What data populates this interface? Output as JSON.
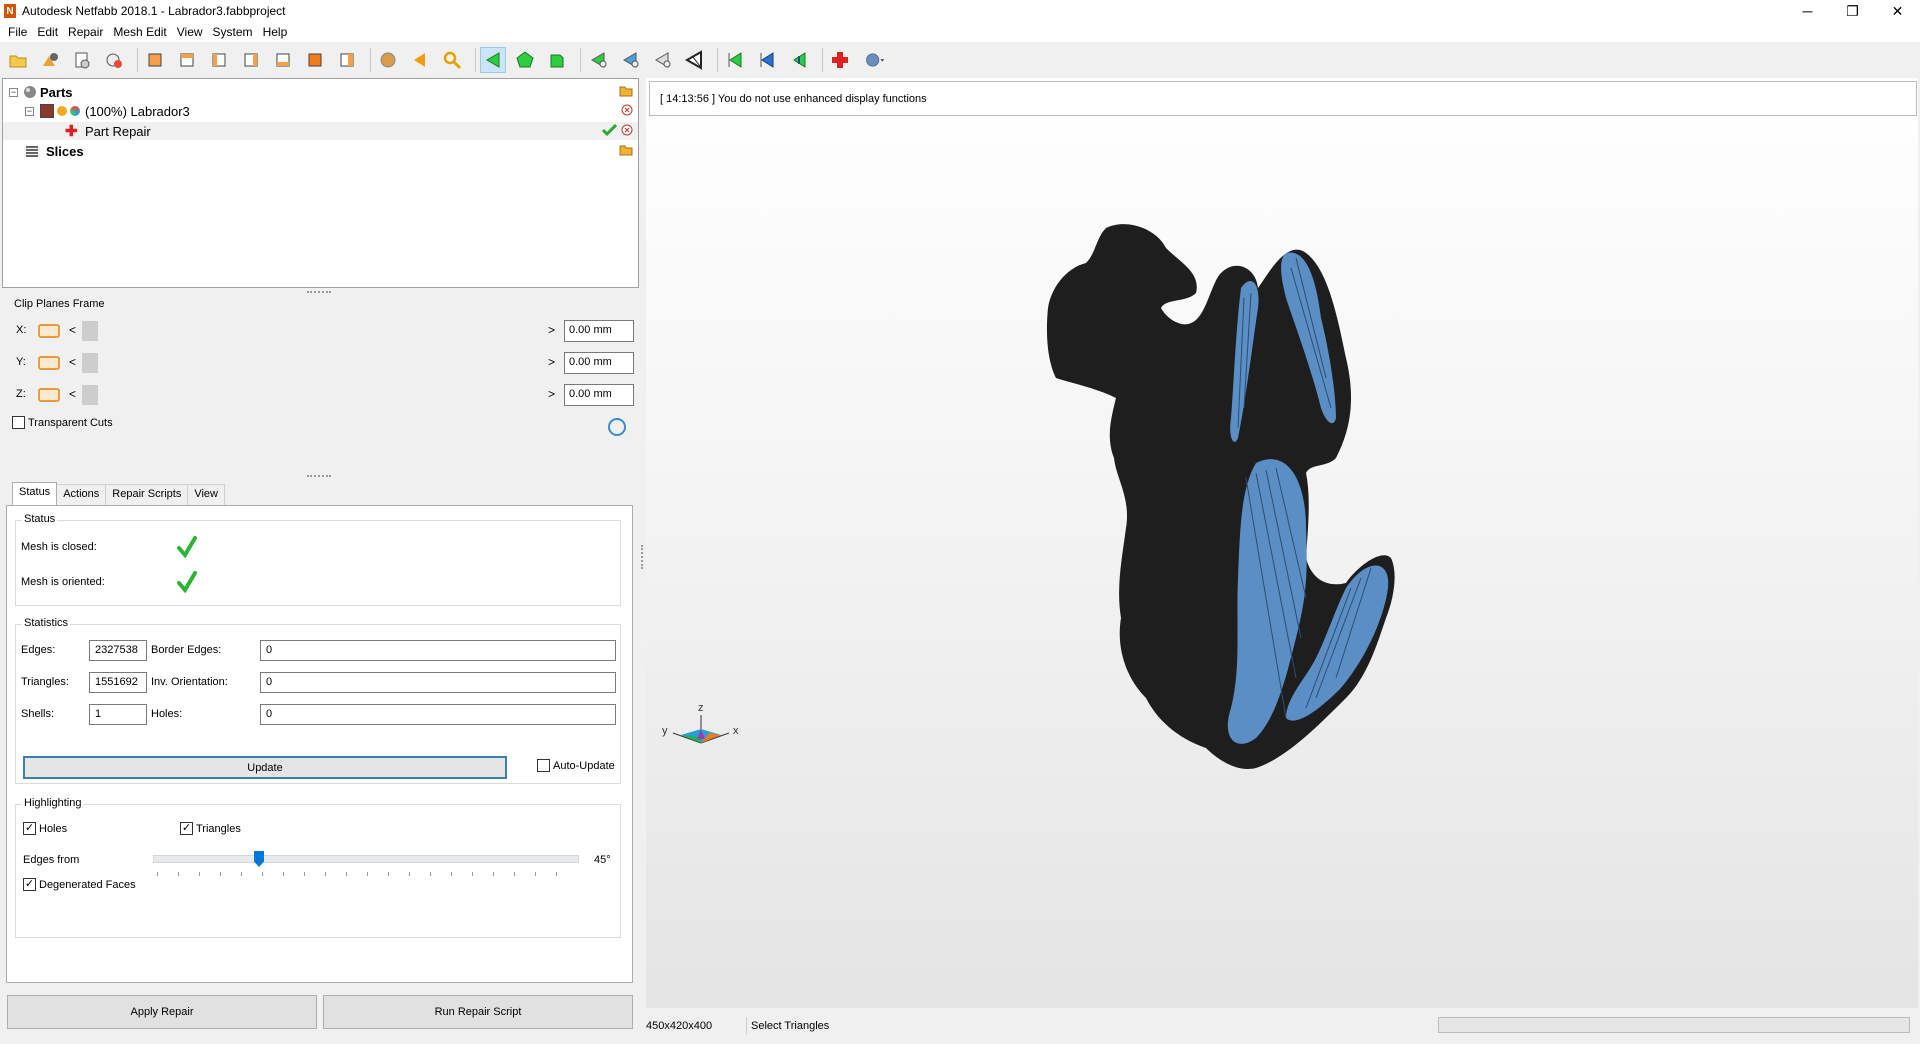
{
  "window": {
    "title": "Autodesk Netfabb 2018.1 - Labrador3.fabbproject",
    "app_icon": "netfabb-logo-icon",
    "minimize": "─",
    "restore": "❐",
    "close": "✕"
  },
  "menu": [
    "File",
    "Edit",
    "Repair",
    "Mesh Edit",
    "View",
    "System",
    "Help"
  ],
  "toolbar": {
    "icons": [
      "open-project-icon",
      "add-part-icon",
      "print-icon",
      "new-icon",
      "view-front-icon",
      "view-back-icon",
      "view-left-icon",
      "view-right-icon",
      "view-top-icon",
      "view-bottom-icon",
      "view-iso-icon",
      "shading-icon",
      "prev-icon",
      "zoom-icon",
      "select-triangle-icon",
      "select-surface-icon",
      "select-shell-icon",
      "select-plane-icon",
      "select-planar-icon",
      "brush-icon",
      "brush-dark-icon",
      "mark-icon",
      "mark-blue-icon",
      "mark-green-icon",
      "repair-icon",
      "help-icon"
    ]
  },
  "tree": {
    "parts_label": "Parts",
    "part_name": "(100%) Labrador3",
    "repair_label": "Part Repair",
    "slices_label": "Slices"
  },
  "clip": {
    "title": "Clip Planes Frame",
    "rows": [
      {
        "axis": "X:",
        "value": "0.00 mm"
      },
      {
        "axis": "Y:",
        "value": "0.00 mm"
      },
      {
        "axis": "Z:",
        "value": "0.00 mm"
      }
    ],
    "less": "<",
    "greater": ">",
    "transparent_cuts": "Transparent Cuts"
  },
  "tabs": [
    "Status",
    "Actions",
    "Repair Scripts",
    "View"
  ],
  "status": {
    "group_title": "Status",
    "closed_label": "Mesh is closed:",
    "oriented_label": "Mesh is oriented:"
  },
  "statistics": {
    "group_title": "Statistics",
    "edges_label": "Edges:",
    "edges": "2327538",
    "border_edges_label": "Border Edges:",
    "border_edges": "0",
    "triangles_label": "Triangles:",
    "triangles": "1551692",
    "inv_orientation_label": "Inv. Orientation:",
    "inv_orientation": "0",
    "shells_label": "Shells:",
    "shells": "1",
    "holes_label": "Holes:",
    "holes": "0",
    "update": "Update",
    "auto_update": "Auto-Update"
  },
  "highlighting": {
    "group_title": "Highlighting",
    "holes": "Holes",
    "holes_checked": true,
    "triangles": "Triangles",
    "triangles_checked": true,
    "edges_from": "Edges from",
    "edges_from_value": "45°",
    "degenerated": "Degenerated Faces",
    "degenerated_checked": true
  },
  "buttons": {
    "apply_repair": "Apply Repair",
    "run_script": "Run Repair Script"
  },
  "viewport": {
    "log": "[ 14:13:56 ] You do not use enhanced display functions",
    "axis_z": "z",
    "axis_y": "y",
    "axis_x": "x",
    "mesh_color": "#1e1e1e",
    "highlight_color": "#5b8ec4"
  },
  "statusbar": {
    "dimensions": "450x420x400",
    "mode": "Select Triangles"
  }
}
